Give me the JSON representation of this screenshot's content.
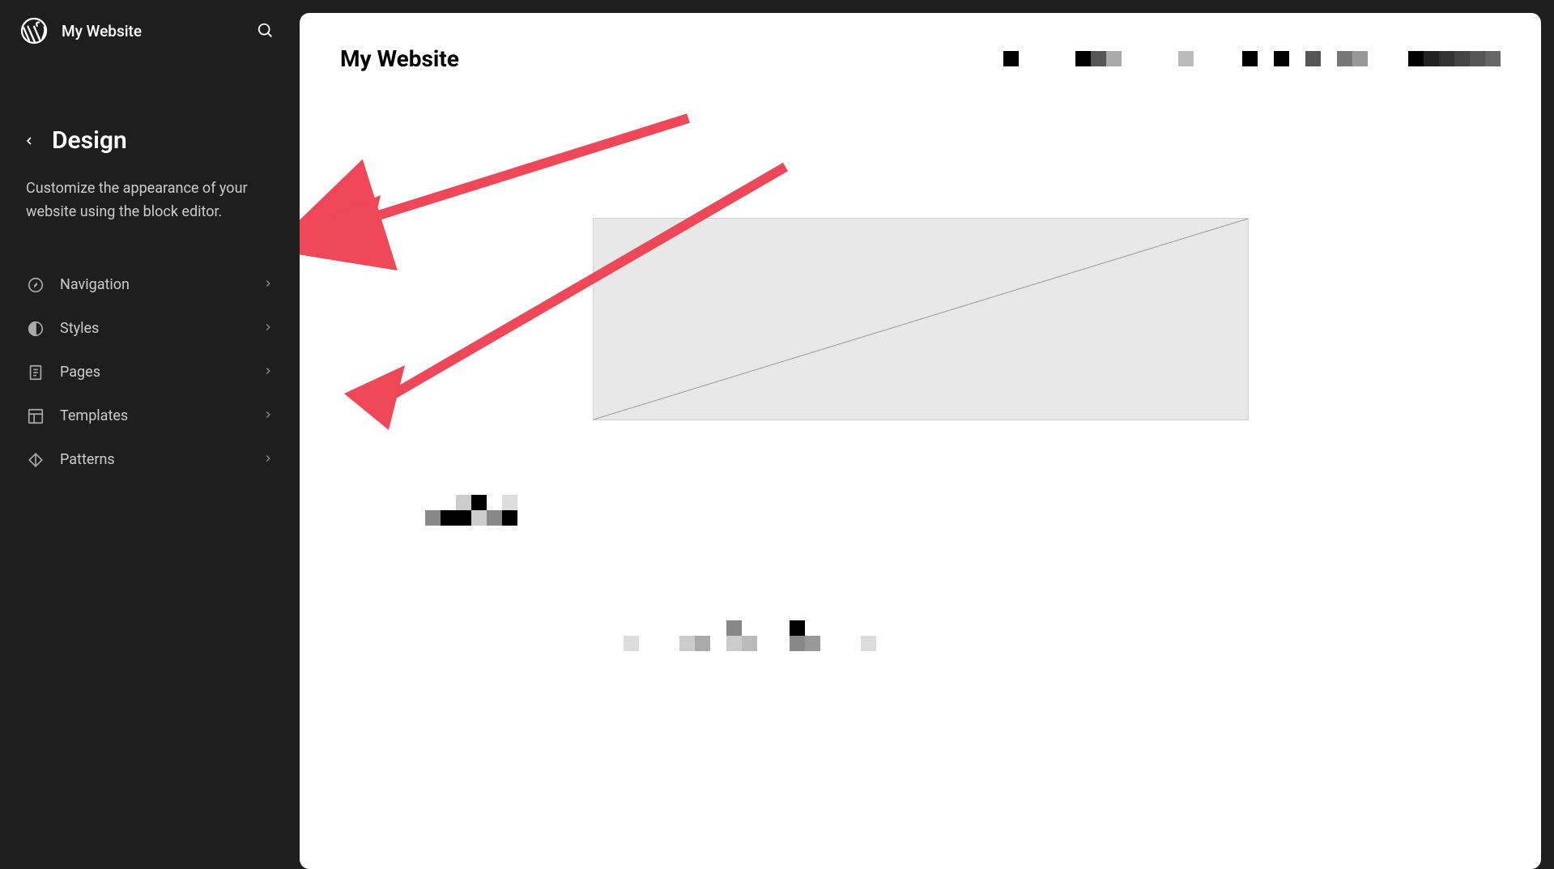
{
  "header": {
    "site_title": "My Website"
  },
  "design": {
    "title": "Design",
    "description": "Customize the appearance of your website using the block editor."
  },
  "nav": {
    "items": [
      {
        "label": "Navigation",
        "icon": "compass"
      },
      {
        "label": "Styles",
        "icon": "half-circle"
      },
      {
        "label": "Pages",
        "icon": "document"
      },
      {
        "label": "Templates",
        "icon": "layout"
      },
      {
        "label": "Patterns",
        "icon": "diamond"
      }
    ]
  },
  "preview": {
    "site_title": "My Website"
  }
}
